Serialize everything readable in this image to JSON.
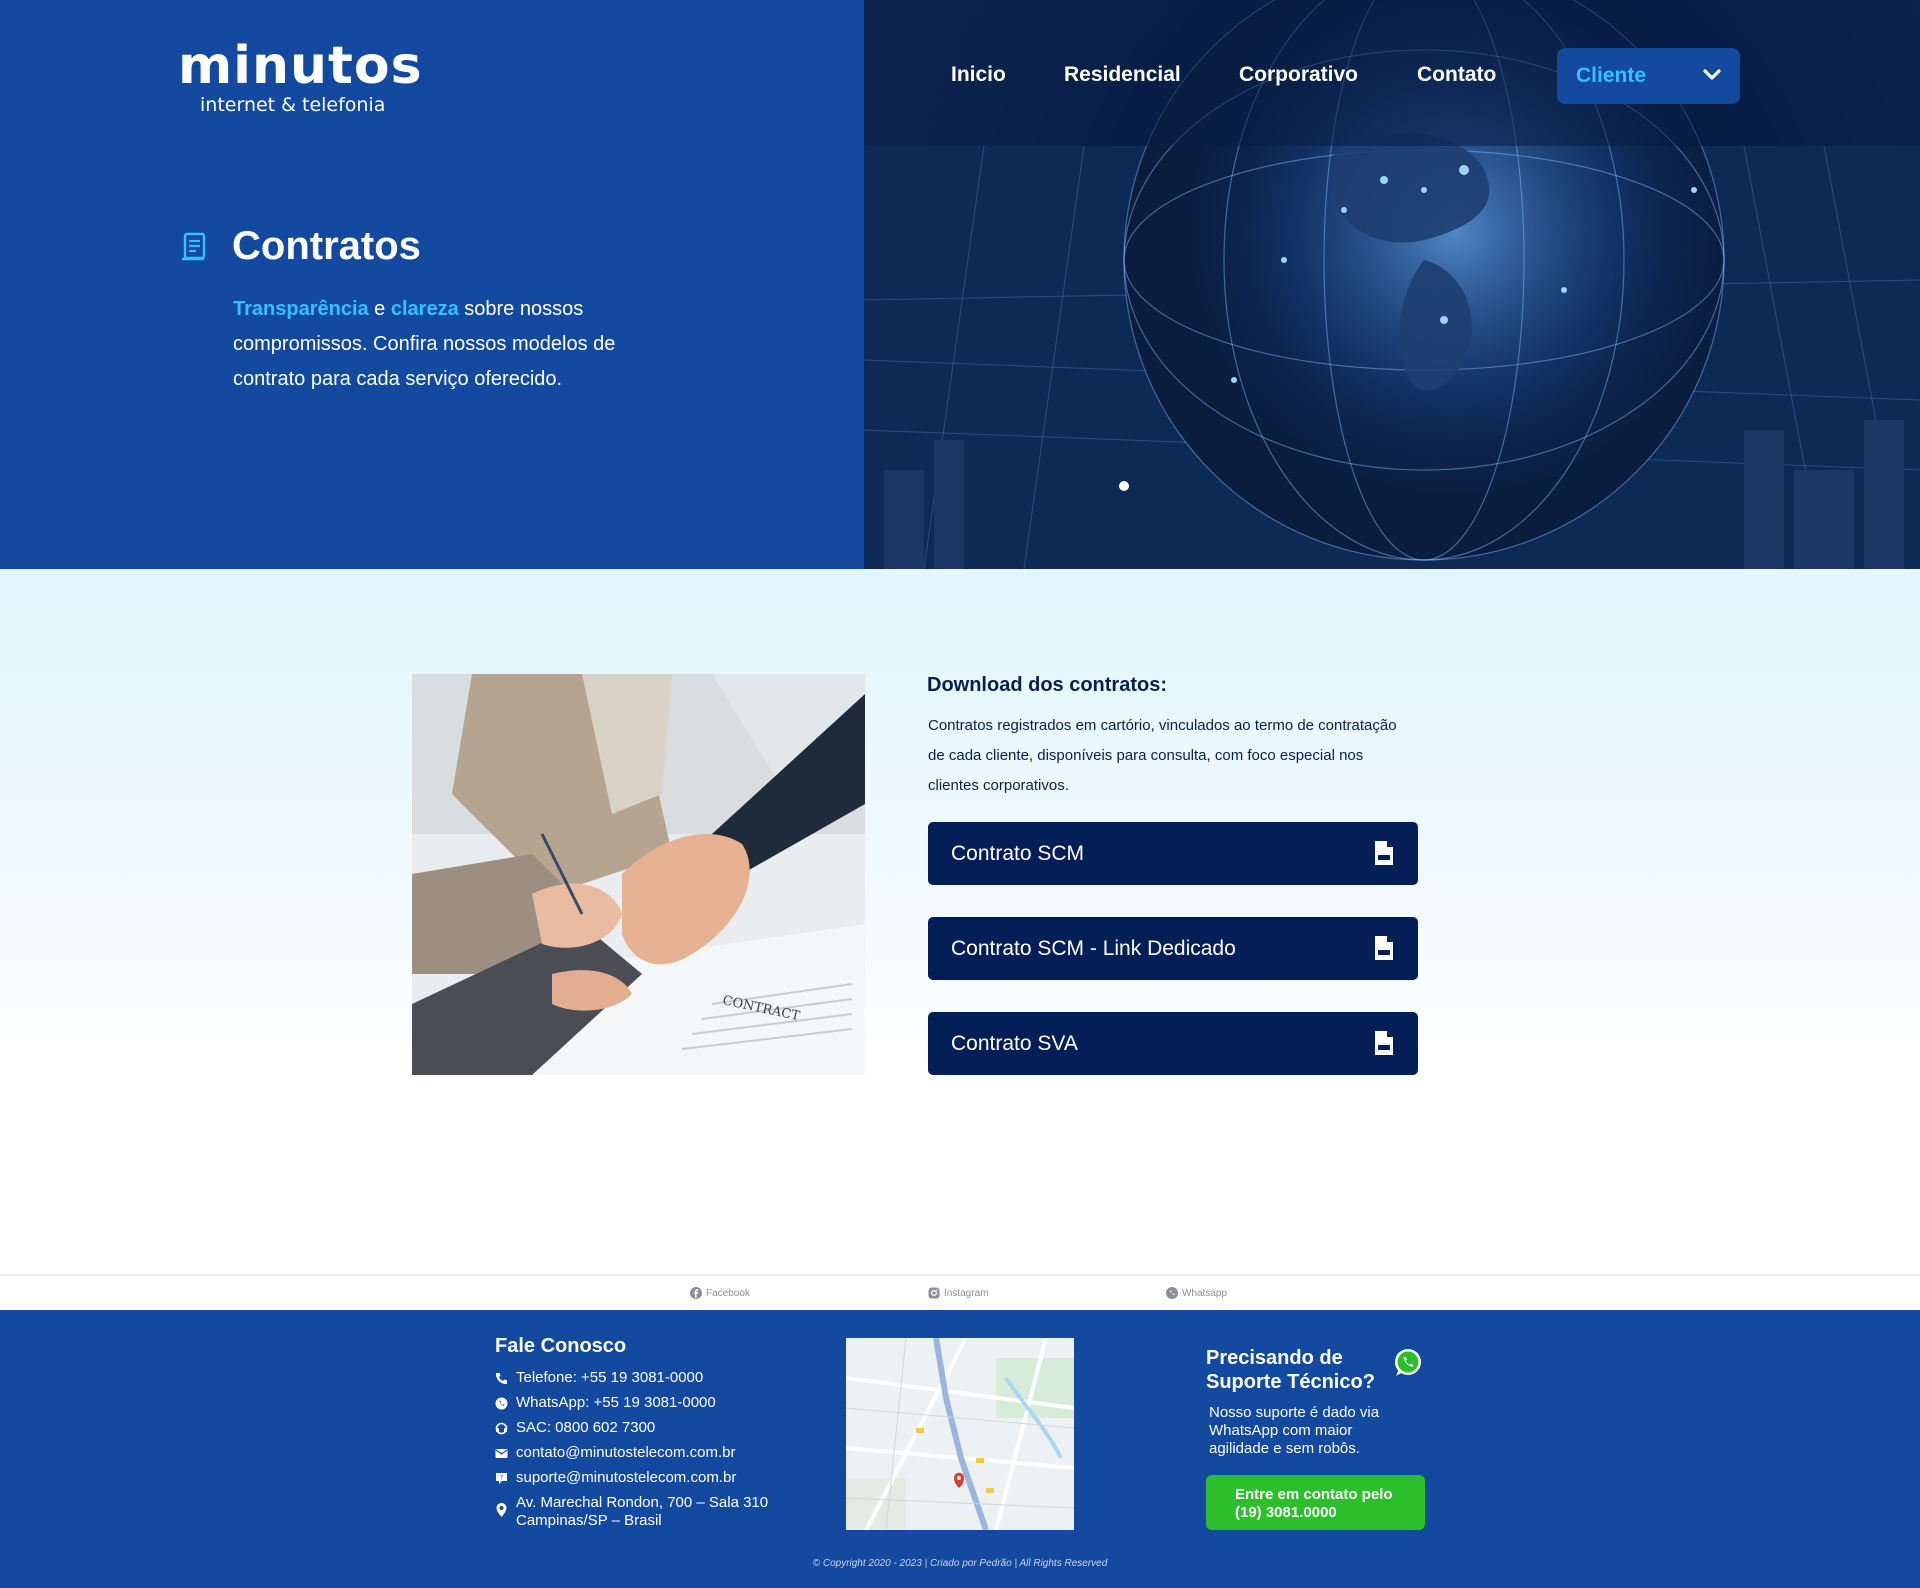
{
  "brand": {
    "name": "minutos",
    "tagline": "internet & telefonia"
  },
  "nav": {
    "items": [
      "Inicio",
      "Residencial",
      "Corporativo",
      "Contato"
    ],
    "client_dropdown": "Cliente"
  },
  "hero": {
    "title": "Contratos",
    "desc_highlight_1": "Transparência",
    "desc_join": " e ",
    "desc_highlight_2": "clareza",
    "desc_rest": " sobre nossos compromissos. Confira nossos modelos de contrato para cada serviço oferecido."
  },
  "downloads": {
    "title": "Download dos contratos:",
    "description": "Contratos registrados em cartório, vinculados ao termo de contratação de cada cliente, disponíveis para consulta, com foco especial nos clientes corporativos.",
    "contracts": [
      "Contrato SCM",
      "Contrato SCM - Link Dedicado",
      "Contrato SVA"
    ],
    "photo_caption": "CONTRACT"
  },
  "social": {
    "facebook": "Facebook",
    "instagram": "Instagram",
    "whatsapp": "Whatsapp"
  },
  "footer": {
    "contact_title": "Fale Conosco",
    "phone": "Telefone: +55 19 3081-0000",
    "whatsapp": "WhatsApp: +55 19 3081-0000",
    "sac": "SAC: 0800 602 7300",
    "email_contact": "contato@minutostelecom.com.br",
    "email_support": "suporte@minutostelecom.com.br",
    "address_1": "Av. Marechal Rondon, 700 – Sala 310",
    "address_2": "Campinas/SP – Brasil",
    "support_title": "Precisando de Suporte Técnico?",
    "support_text": "Nosso suporte é dado via WhatsApp com maior agilidade e sem robôs.",
    "support_button_1": "Entre em contato pelo",
    "support_button_2": "(19) 3081.0000",
    "copyright": "© Copyright 2020 - 2023 | Criado por Pedrão | All Rights Reserved"
  },
  "colors": {
    "primary_blue": "#1449a0",
    "accent_cyan": "#33c1ff",
    "navy_button": "#041e57",
    "whatsapp_green": "#2cbf2c"
  },
  "icons": {
    "title": "document-icon",
    "chevron": "chevron-down-icon",
    "pdf": "pdf-file-icon",
    "whatsapp": "whatsapp-icon"
  }
}
